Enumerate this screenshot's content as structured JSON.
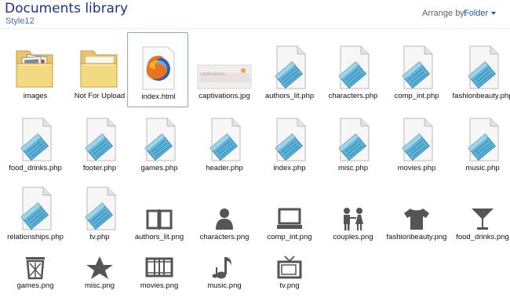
{
  "header": {
    "title": "Documents library",
    "subtitle": "Style12",
    "arrange_label": "Arrange by:",
    "arrange_value": "Folder"
  },
  "items": [
    {
      "label": "images",
      "icon": "folder-photos-icon"
    },
    {
      "label": "Not For Upload",
      "icon": "folder-icon"
    },
    {
      "label": "index.html",
      "icon": "firefox-html-icon",
      "selected": true
    },
    {
      "label": "captivations.jpg",
      "icon": "image-thumbnail-icon",
      "thumb_text": "captivations"
    },
    {
      "label": "authors_lit.php",
      "icon": "notepad-file-icon"
    },
    {
      "label": "characters.php",
      "icon": "notepad-file-icon"
    },
    {
      "label": "comp_int.php",
      "icon": "notepad-file-icon"
    },
    {
      "label": "fashionbeauty.php",
      "icon": "notepad-file-icon"
    },
    {
      "label": "food_drinks.php",
      "icon": "notepad-file-icon"
    },
    {
      "label": "footer.php",
      "icon": "notepad-file-icon"
    },
    {
      "label": "games.php",
      "icon": "notepad-file-icon"
    },
    {
      "label": "header.php",
      "icon": "notepad-file-icon"
    },
    {
      "label": "index.php",
      "icon": "notepad-file-icon"
    },
    {
      "label": "misc.php",
      "icon": "notepad-file-icon"
    },
    {
      "label": "movies.php",
      "icon": "notepad-file-icon"
    },
    {
      "label": "music.php",
      "icon": "notepad-file-icon"
    },
    {
      "label": "relationships.php",
      "icon": "notepad-file-icon"
    },
    {
      "label": "tv.php",
      "icon": "notepad-file-icon"
    },
    {
      "label": "authors_lit.png",
      "icon": "book-icon"
    },
    {
      "label": "characters.png",
      "icon": "person-icon"
    },
    {
      "label": "comp_int.png",
      "icon": "computer-icon"
    },
    {
      "label": "couples.png",
      "icon": "couple-icon"
    },
    {
      "label": "fashionbeauty.png",
      "icon": "tshirt-icon"
    },
    {
      "label": "food_drinks.png",
      "icon": "cocktail-icon"
    },
    {
      "label": "games.png",
      "icon": "trash-bin-icon"
    },
    {
      "label": "misc.png",
      "icon": "star-icon"
    },
    {
      "label": "movies.png",
      "icon": "film-strip-icon"
    },
    {
      "label": "music.png",
      "icon": "music-note-icon"
    },
    {
      "label": "tv.png",
      "icon": "tv-icon"
    }
  ]
}
